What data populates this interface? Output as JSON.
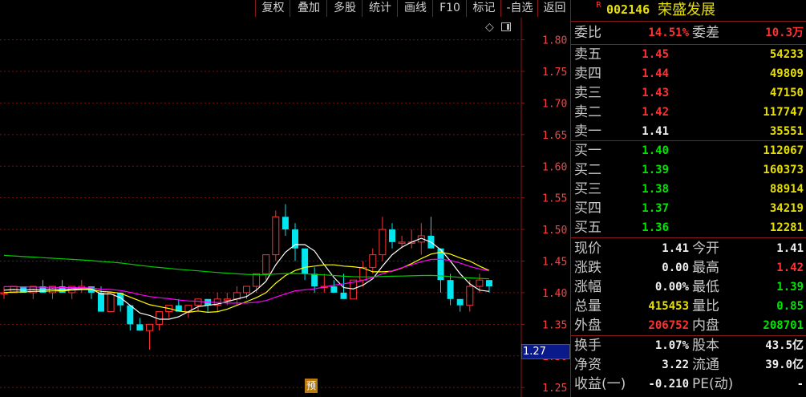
{
  "colors": {
    "up": "#ff3232",
    "down": "#00e5ee",
    "ma5": "#ffffff",
    "ma10": "#ffff00",
    "ma20": "#ff00ff",
    "ma60": "#00cc00",
    "grid": "#7a1010",
    "axis_text": "#ff4040"
  },
  "toolbar": {
    "items": [
      "复权",
      "叠加",
      "多股",
      "统计",
      "画线",
      "F10",
      "标记",
      "-自选",
      "返回"
    ]
  },
  "chart": {
    "markers": {
      "yu": "预"
    },
    "price_tag": "1.27",
    "icons": {
      "diamond": "◇",
      "panel_toggle": "panel-toggle-icon"
    }
  },
  "chart_data": {
    "type": "candlestick",
    "y_ticks": [
      "1.80",
      "1.75",
      "1.70",
      "1.65",
      "1.60",
      "1.55",
      "1.50",
      "1.45",
      "1.40",
      "1.35",
      "1.30",
      "1.25"
    ],
    "ylim": [
      1.235,
      1.835
    ],
    "candles": [
      [
        1.4,
        1.41,
        1.39,
        1.4
      ],
      [
        1.4,
        1.41,
        1.4,
        1.41
      ],
      [
        1.41,
        1.41,
        1.4,
        1.4
      ],
      [
        1.4,
        1.41,
        1.39,
        1.41
      ],
      [
        1.41,
        1.42,
        1.4,
        1.4
      ],
      [
        1.4,
        1.41,
        1.39,
        1.41
      ],
      [
        1.41,
        1.42,
        1.4,
        1.4
      ],
      [
        1.4,
        1.41,
        1.39,
        1.41
      ],
      [
        1.41,
        1.42,
        1.4,
        1.41
      ],
      [
        1.41,
        1.41,
        1.39,
        1.4
      ],
      [
        1.4,
        1.41,
        1.37,
        1.37
      ],
      [
        1.37,
        1.4,
        1.37,
        1.4
      ],
      [
        1.4,
        1.4,
        1.37,
        1.38
      ],
      [
        1.38,
        1.38,
        1.34,
        1.35
      ],
      [
        1.35,
        1.36,
        1.34,
        1.34
      ],
      [
        1.34,
        1.35,
        1.31,
        1.35
      ],
      [
        1.35,
        1.37,
        1.34,
        1.37
      ],
      [
        1.37,
        1.38,
        1.36,
        1.38
      ],
      [
        1.38,
        1.39,
        1.37,
        1.37
      ],
      [
        1.37,
        1.38,
        1.36,
        1.38
      ],
      [
        1.38,
        1.39,
        1.37,
        1.39
      ],
      [
        1.39,
        1.39,
        1.37,
        1.38
      ],
      [
        1.38,
        1.4,
        1.37,
        1.39
      ],
      [
        1.39,
        1.4,
        1.38,
        1.39
      ],
      [
        1.39,
        1.41,
        1.38,
        1.4
      ],
      [
        1.4,
        1.41,
        1.39,
        1.41
      ],
      [
        1.41,
        1.43,
        1.4,
        1.43
      ],
      [
        1.43,
        1.46,
        1.42,
        1.46
      ],
      [
        1.46,
        1.53,
        1.45,
        1.52
      ],
      [
        1.52,
        1.54,
        1.49,
        1.5
      ],
      [
        1.5,
        1.51,
        1.45,
        1.47
      ],
      [
        1.47,
        1.47,
        1.42,
        1.43
      ],
      [
        1.43,
        1.44,
        1.4,
        1.41
      ],
      [
        1.41,
        1.43,
        1.4,
        1.41
      ],
      [
        1.41,
        1.42,
        1.4,
        1.4
      ],
      [
        1.4,
        1.43,
        1.39,
        1.39
      ],
      [
        1.39,
        1.42,
        1.39,
        1.42
      ],
      [
        1.42,
        1.45,
        1.41,
        1.44
      ],
      [
        1.44,
        1.47,
        1.43,
        1.46
      ],
      [
        1.46,
        1.52,
        1.45,
        1.5
      ],
      [
        1.5,
        1.51,
        1.47,
        1.48
      ],
      [
        1.48,
        1.49,
        1.47,
        1.48
      ],
      [
        1.48,
        1.5,
        1.47,
        1.48
      ],
      [
        1.48,
        1.51,
        1.46,
        1.49
      ],
      [
        1.49,
        1.52,
        1.47,
        1.47
      ],
      [
        1.47,
        1.47,
        1.4,
        1.42
      ],
      [
        1.42,
        1.43,
        1.38,
        1.39
      ],
      [
        1.39,
        1.39,
        1.37,
        1.38
      ],
      [
        1.38,
        1.42,
        1.37,
        1.41
      ],
      [
        1.41,
        1.43,
        1.4,
        1.42
      ],
      [
        1.42,
        1.42,
        1.4,
        1.41
      ]
    ],
    "ma_periods": [
      5,
      10,
      20,
      60
    ]
  },
  "quote": {
    "code": "002146",
    "name": "荣盛发展",
    "r_mark": "R",
    "wei_bi": {
      "label": "委比",
      "value": "14.51%"
    },
    "wei_cha": {
      "label": "委差",
      "value": "10.3万"
    },
    "asks": [
      {
        "label": "卖五",
        "price": "1.45",
        "vol": "54233"
      },
      {
        "label": "卖四",
        "price": "1.44",
        "vol": "49809"
      },
      {
        "label": "卖三",
        "price": "1.43",
        "vol": "47150"
      },
      {
        "label": "卖二",
        "price": "1.42",
        "vol": "117747"
      },
      {
        "label": "卖一",
        "price": "1.41",
        "vol": "35551"
      }
    ],
    "bids": [
      {
        "label": "买一",
        "price": "1.40",
        "vol": "112067"
      },
      {
        "label": "买二",
        "price": "1.39",
        "vol": "160373"
      },
      {
        "label": "买三",
        "price": "1.38",
        "vol": "88914"
      },
      {
        "label": "买四",
        "price": "1.37",
        "vol": "34219"
      },
      {
        "label": "买五",
        "price": "1.36",
        "vol": "12281"
      }
    ],
    "stats1": [
      {
        "l1": "现价",
        "v1": "1.41",
        "c1": "white",
        "l2": "今开",
        "v2": "1.41",
        "c2": "white"
      },
      {
        "l1": "涨跌",
        "v1": "0.00",
        "c1": "white",
        "l2": "最高",
        "v2": "1.42",
        "c2": "red"
      },
      {
        "l1": "涨幅",
        "v1": "0.00%",
        "c1": "white",
        "l2": "最低",
        "v2": "1.39",
        "c2": "green"
      },
      {
        "l1": "总量",
        "v1": "415453",
        "c1": "yellow",
        "l2": "量比",
        "v2": "0.85",
        "c2": "green"
      },
      {
        "l1": "外盘",
        "v1": "206752",
        "c1": "red",
        "l2": "内盘",
        "v2": "208701",
        "c2": "green"
      }
    ],
    "stats2": [
      {
        "l1": "换手",
        "v1": "1.07%",
        "c1": "white",
        "l2": "股本",
        "v2": "43.5亿",
        "c2": "white"
      },
      {
        "l1": "净资",
        "v1": "3.22",
        "c1": "white",
        "l2": "流通",
        "v2": "39.0亿",
        "c2": "white"
      },
      {
        "l1": "收益(一)",
        "v1": "-0.210",
        "c1": "white",
        "l2": "PE(动)",
        "v2": "-",
        "c2": "white"
      }
    ]
  }
}
